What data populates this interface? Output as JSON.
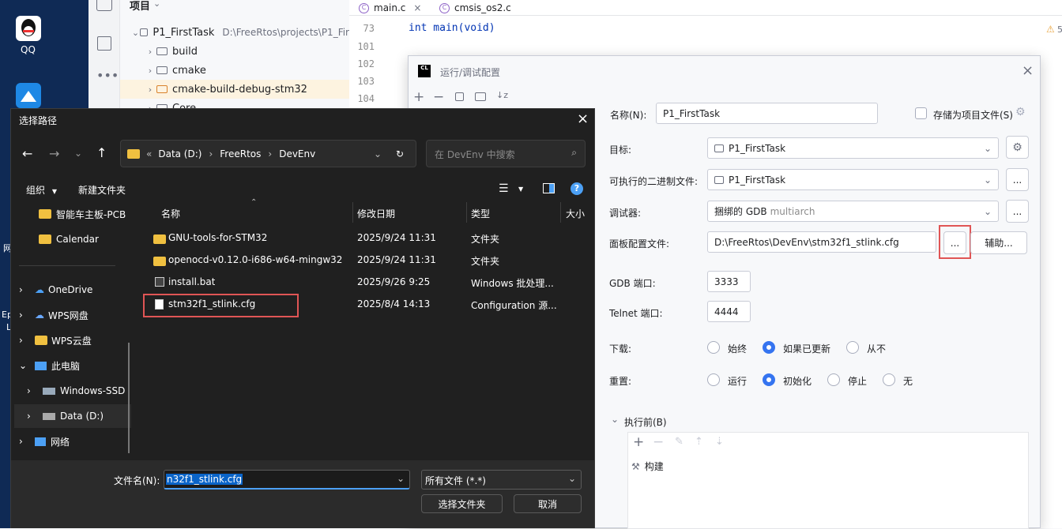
{
  "desktop": {
    "qq_label": "QQ",
    "partial_labels": [
      "网",
      "Ep",
      "L"
    ]
  },
  "ide": {
    "tree_header": "项目",
    "tree": [
      {
        "label": "P1_FirstTask",
        "path": "D:\\FreeRtos\\projects\\P1_Fir"
      },
      {
        "label": "build"
      },
      {
        "label": "cmake"
      },
      {
        "label": "cmake-build-debug-stm32"
      },
      {
        "label": "Core"
      }
    ],
    "tabs": [
      {
        "label": "main.c"
      },
      {
        "label": "cmsis_os2.c"
      }
    ],
    "line_numbers": [
      "73",
      "101",
      "102",
      "103",
      "104"
    ],
    "code_line": "int main(void)",
    "warning_count": "5"
  },
  "run_config": {
    "title": "运行/调试配置",
    "name_label": "名称(N):",
    "name_value": "P1_FirstTask",
    "store_label": "存储为项目文件(S)",
    "target_label": "目标:",
    "target_value": "P1_FirstTask",
    "binary_label": "可执行的二进制文件:",
    "binary_value": "P1_FirstTask",
    "debugger_label": "调试器:",
    "debugger_value": "捆绑的 GDB",
    "debugger_hint": "multiarch",
    "board_label": "面板配置文件:",
    "board_value": "D:\\FreeRtos\\DevEnv\\stm32f1_stlink.cfg",
    "browse": "...",
    "assist": "辅助...",
    "gdb_port_label": "GDB 端口:",
    "gdb_port": "3333",
    "telnet_port_label": "Telnet 端口:",
    "telnet_port": "4444",
    "download_label": "下载:",
    "download_options": [
      "始终",
      "如果已更新",
      "从不"
    ],
    "download_selected": 1,
    "reset_label": "重置:",
    "reset_options": [
      "运行",
      "初始化",
      "停止",
      "无"
    ],
    "reset_selected": 1,
    "before_label": "执行前(B)",
    "build_item": "构建"
  },
  "file_dialog": {
    "title": "选择路径",
    "breadcrumb": [
      "Data (D:)",
      "FreeRtos",
      "DevEnv"
    ],
    "search_placeholder": "在 DevEnv 中搜索",
    "organize": "组织",
    "new_folder": "新建文件夹",
    "nav": [
      {
        "label": "智能车主板-PCB",
        "icon": "folder-icon"
      },
      {
        "label": "Calendar",
        "icon": "folder-icon"
      },
      {
        "label": "OneDrive",
        "icon": "cloud-icon"
      },
      {
        "label": "WPS网盘",
        "icon": "cloud-icon"
      },
      {
        "label": "WPS云盘",
        "icon": "folder-icon"
      },
      {
        "label": "此电脑",
        "icon": "pc-icon"
      },
      {
        "label": "Windows-SSD",
        "icon": "drive-icon"
      },
      {
        "label": "Data (D:)",
        "icon": "drive-icon"
      },
      {
        "label": "网络",
        "icon": "network-icon"
      }
    ],
    "columns": [
      "名称",
      "修改日期",
      "类型",
      "大小"
    ],
    "files": [
      {
        "name": "GNU-tools-for-STM32",
        "date": "2025/9/24 11:31",
        "type": "文件夹",
        "kind": "folder"
      },
      {
        "name": "openocd-v0.12.0-i686-w64-mingw32",
        "date": "2025/9/24 11:31",
        "type": "文件夹",
        "kind": "folder"
      },
      {
        "name": "install.bat",
        "date": "2025/9/26 9:25",
        "type": "Windows 批处理...",
        "kind": "file"
      },
      {
        "name": "stm32f1_stlink.cfg",
        "date": "2025/8/4 14:13",
        "type": "Configuration 源...",
        "kind": "file"
      }
    ],
    "filename_label": "文件名(N):",
    "filename_value": "n32f1_stlink.cfg",
    "filter_value": "所有文件 (*.*)",
    "select_button": "选择文件夹",
    "cancel_button": "取消"
  }
}
